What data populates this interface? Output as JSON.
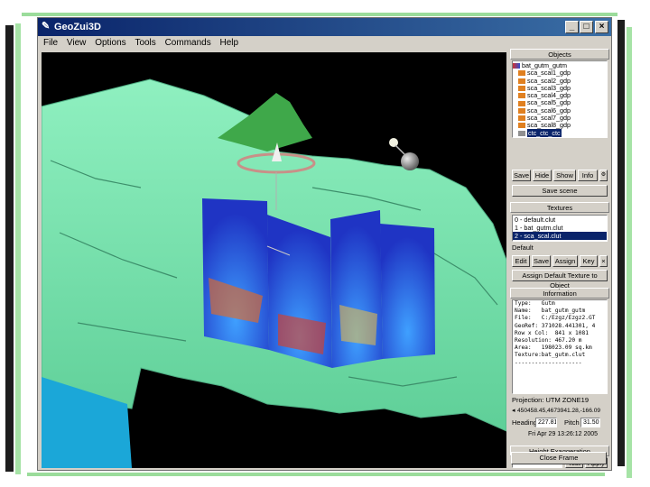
{
  "window": {
    "title": "GeoZui3D"
  },
  "menu": [
    "File",
    "View",
    "Options",
    "Tools",
    "Commands",
    "Help"
  ],
  "title_buttons": {
    "minimize": "_",
    "maximize": "□",
    "close": "×"
  },
  "objects": {
    "title": "Objects",
    "items": [
      "bat_gutm_gutm",
      "sca_scal1_gdp",
      "sca_scal2_gdp",
      "sca_scal3_gdp",
      "sca_scal4_gdp",
      "sca_scal5_gdp",
      "sca_scal6_gdp",
      "sca_scal7_gdp",
      "sca_scal8_gdp",
      "ctc_ctc_ctc"
    ],
    "selected_index": 9,
    "buttons": [
      "Save",
      "Hide",
      "Show",
      "Info"
    ],
    "save_scene": "Save scene"
  },
  "textures": {
    "title": "Textures",
    "items": [
      "0 - default.clut",
      "1 - bat_gutm.clut",
      "2 - sca_scal.clut"
    ],
    "selected_index": 2,
    "default_label": "Default",
    "buttons": [
      "Edit",
      "Save",
      "Assign",
      "Key"
    ],
    "assign_default": "Assign Default Texture to Object"
  },
  "information": {
    "title": "Information",
    "lines": [
      "Type:   Gutm",
      "Name:   bat_gutm_gutm",
      "File:   C:/Ezgz/Ezgz2.GT",
      "GeoRef: 371028.441301, 4",
      "Row x Col:  841 x 1081",
      "Resolution: 467.20 m",
      "Area:   198023.09 sq.km",
      "Texture:bat_gutm.clut",
      "--------------------"
    ]
  },
  "nav": {
    "projection": "Projection:  UTM ZONE19",
    "coords": "450458.45,4673941.28,-166.09",
    "heading_label": "Heading",
    "heading_value": "227.81",
    "pitch_label": "Pitch",
    "pitch_value": "31.50",
    "datetime": "Fri Apr 29 13:26:12 2005"
  },
  "height": {
    "title": "Height Exaggeration",
    "value": "200.000000",
    "test": "Test",
    "apply": "Apply"
  },
  "close_frame": "Close Frame",
  "colors": {
    "title_start": "#0a246a",
    "title_end": "#3a6ea5",
    "terrain": "#7fe9b4",
    "volume": "#2038c8",
    "selection": "#0a246a"
  }
}
